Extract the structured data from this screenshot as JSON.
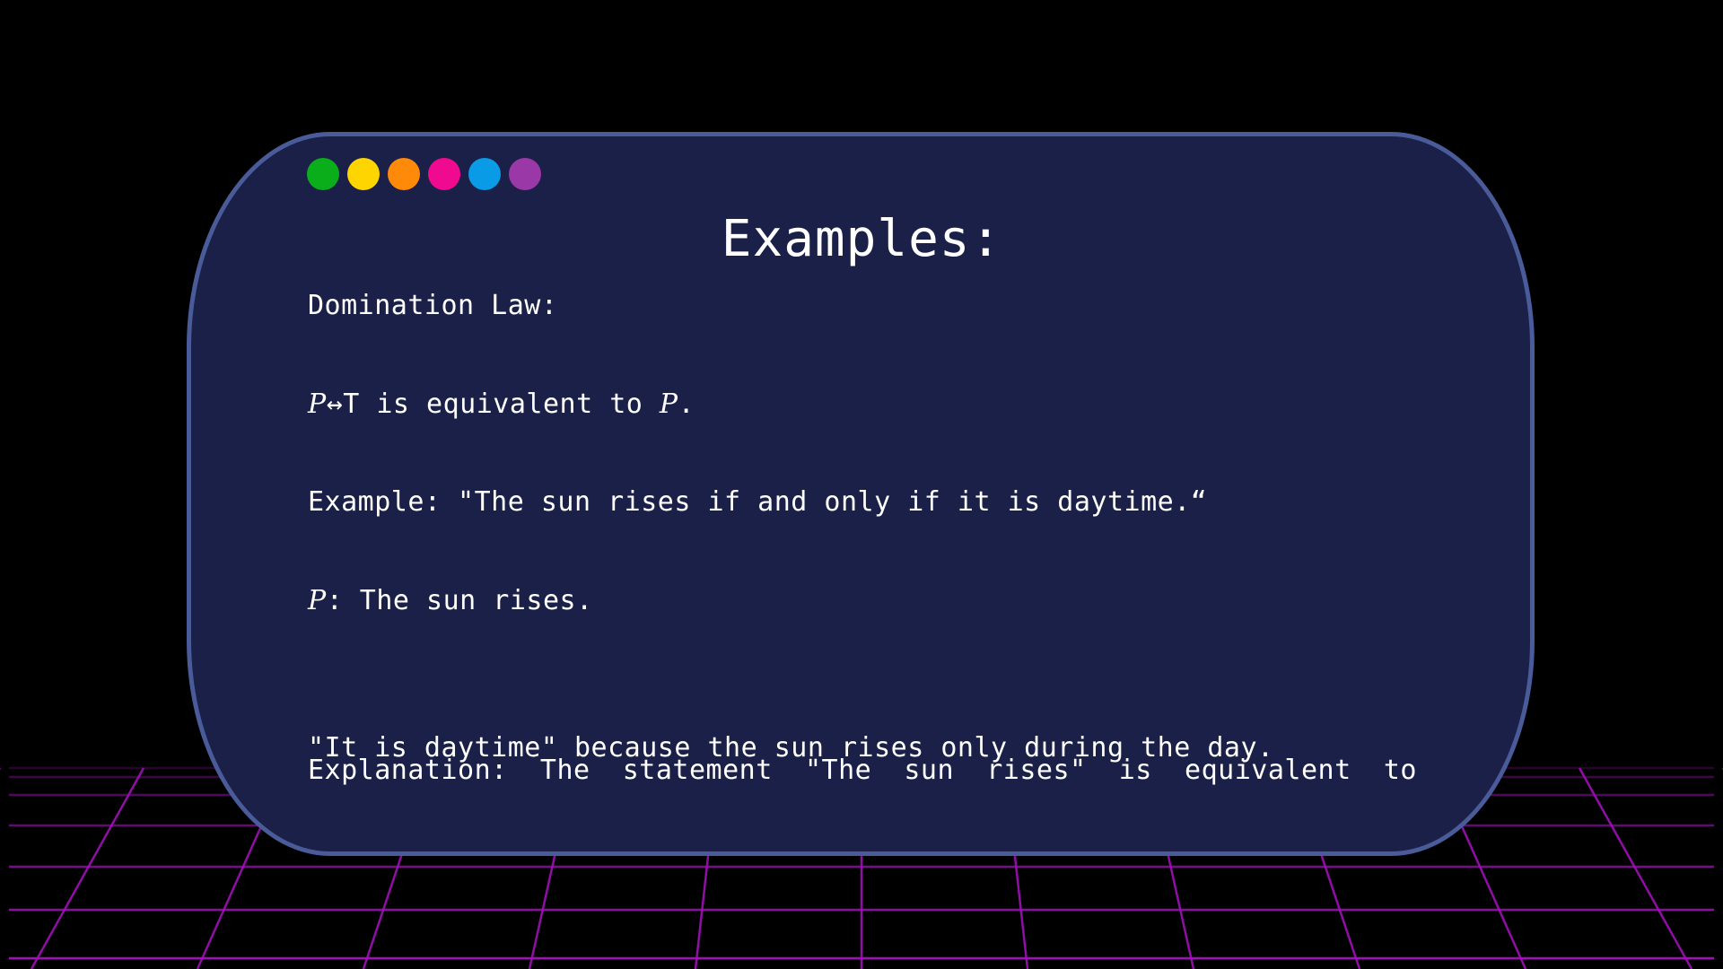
{
  "slide": {
    "title": "Examples:",
    "window_dots": [
      {
        "name": "green",
        "color": "#0aae1a"
      },
      {
        "name": "yellow",
        "color": "#ffd500"
      },
      {
        "name": "orange",
        "color": "#ff8a0a"
      },
      {
        "name": "pink",
        "color": "#ef0a8f"
      },
      {
        "name": "blue",
        "color": "#0a9be6"
      },
      {
        "name": "purple",
        "color": "#9a38a8"
      }
    ],
    "law_heading": "Domination Law:",
    "formula": {
      "var1": "P",
      "operator_text": "↔T is equivalent to ",
      "var2": "P",
      "end": "."
    },
    "example_text": "Example: \"The sun rises if and only if it is daytime.“",
    "definition": {
      "var": "P",
      "text": ": The sun rises."
    },
    "explanation": {
      "words": [
        "Explanation:",
        "The",
        "statement",
        "\"The",
        "sun",
        "rises\"",
        "is",
        "equivalent",
        "to"
      ],
      "line2": "\"It is daytime\" because the sun rises only during the day."
    }
  },
  "colors": {
    "background": "#000000",
    "card_fill": "#1b2048",
    "card_border": "#4a5b9a",
    "grid_line": "#a010b8",
    "text": "#ffffff"
  }
}
